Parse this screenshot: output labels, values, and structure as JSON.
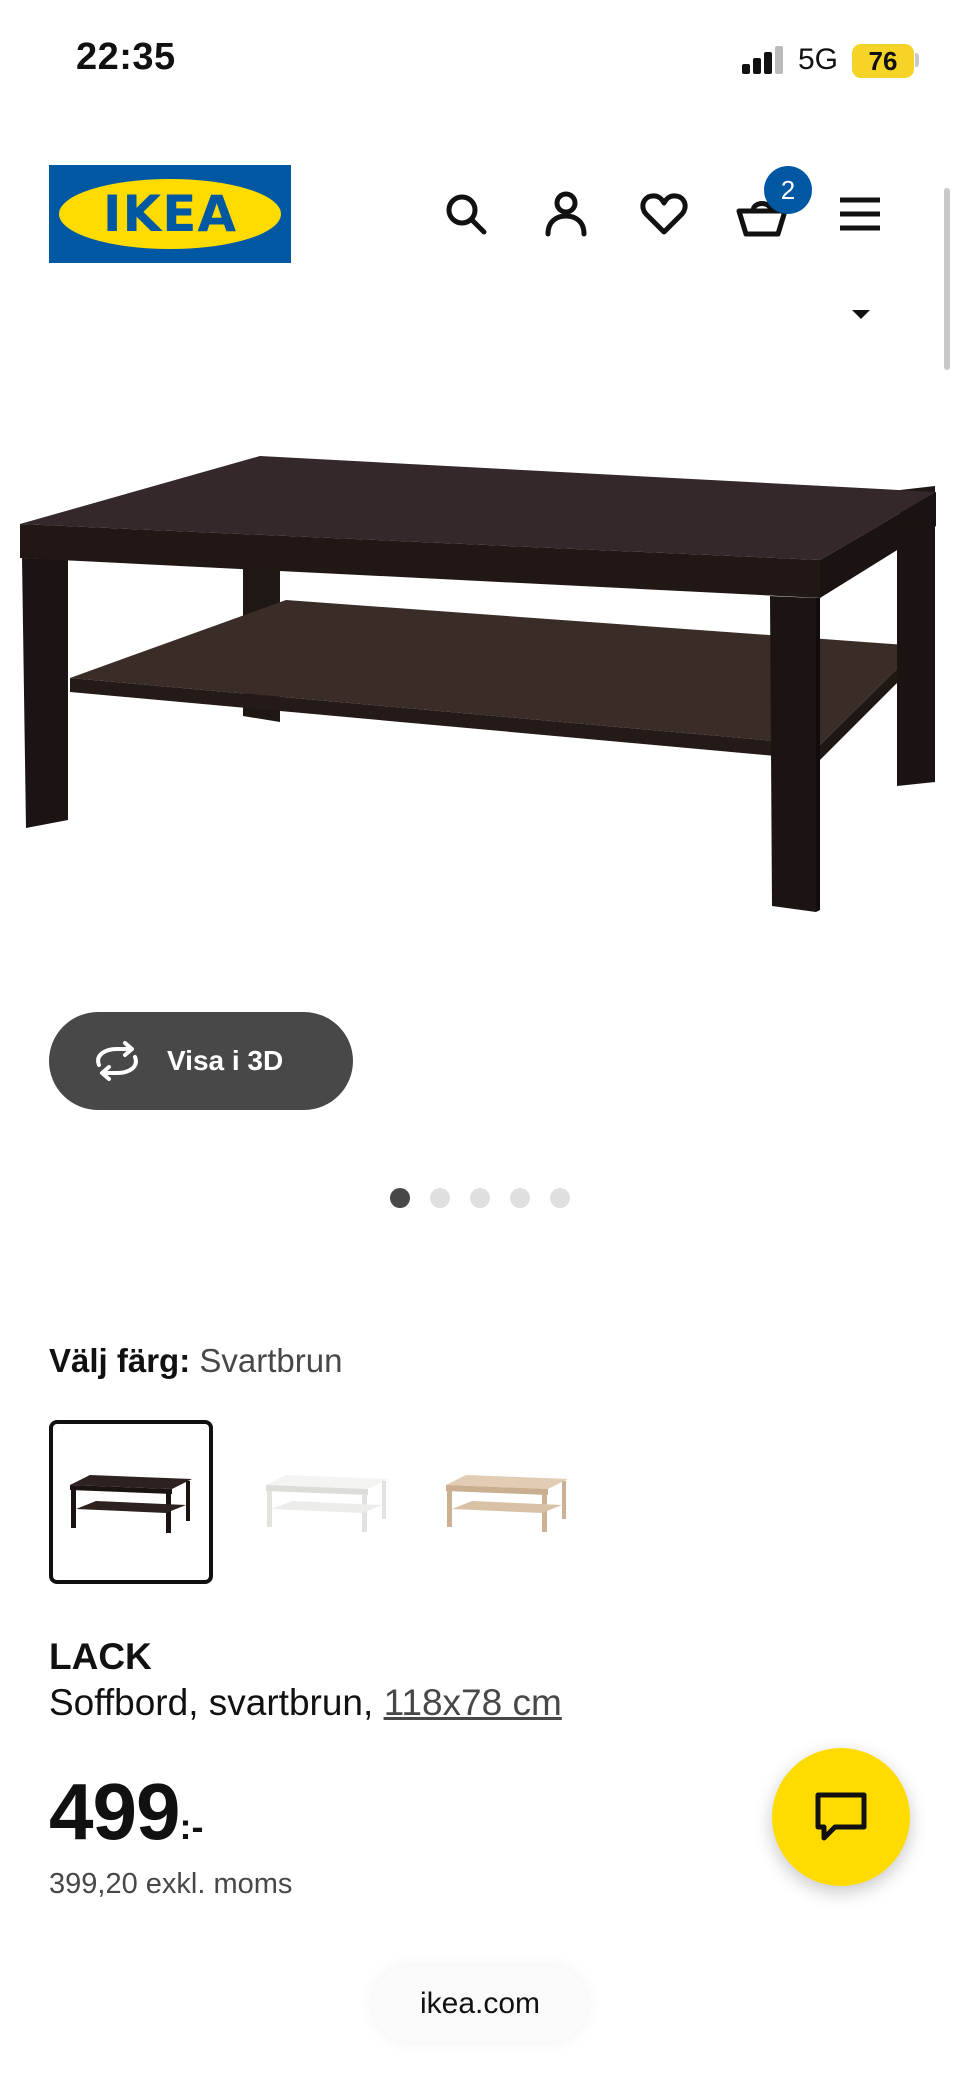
{
  "status_bar": {
    "time": "22:35",
    "network": "5G",
    "battery": "76"
  },
  "header": {
    "logo_text": "IKEA",
    "cart_count": "2",
    "icons": [
      "search-icon",
      "account-icon",
      "heart-icon",
      "cart-icon",
      "menu-icon"
    ]
  },
  "media": {
    "view_3d_label": "Visa i 3D",
    "image_count": 5,
    "active_image": 1
  },
  "color_picker": {
    "label": "Välj färg:",
    "selected": "Svartbrun",
    "options": [
      "svartbrun",
      "vit",
      "vitlaserad ekmönstrad"
    ],
    "selected_index": 0
  },
  "product": {
    "name": "LACK",
    "description": "Soffbord, svartbrun,",
    "size_link": "118x78 cm",
    "price": "499",
    "price_suffix": ":-",
    "price_excl_vat": "399,20 exkl. moms"
  },
  "browser": {
    "url": "ikea.com"
  },
  "colors": {
    "ikea_blue": "#0058a3",
    "ikea_yellow": "#ffdb00",
    "table_dark": "#2b211d",
    "button_dark": "#484848"
  }
}
